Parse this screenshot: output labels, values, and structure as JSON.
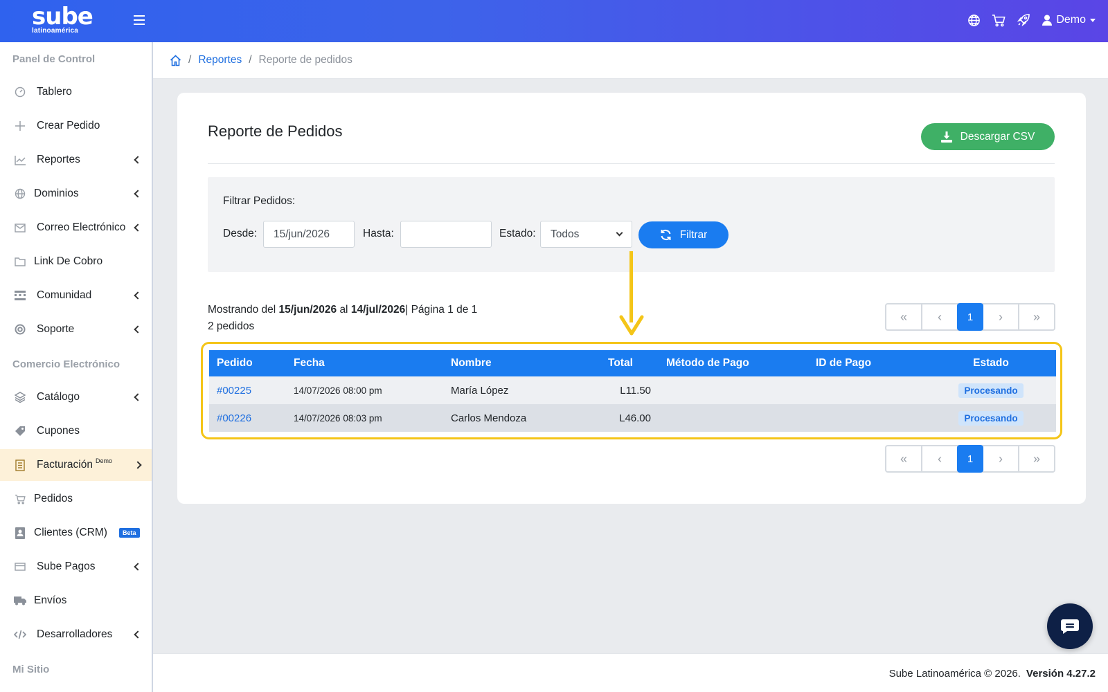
{
  "brand": {
    "name": "sube",
    "tagline": "latinoamérica"
  },
  "header": {
    "user": "Demo"
  },
  "sidebar": {
    "sections": [
      "Panel de Control",
      "Comercio Electrónico",
      "Mi Sitio"
    ],
    "items": [
      {
        "label": "Tablero",
        "icon": "dashboard-icon"
      },
      {
        "label": "Crear Pedido",
        "icon": "plus-icon"
      },
      {
        "label": "Reportes",
        "icon": "chart-icon"
      },
      {
        "label": "Dominios",
        "icon": "globe-icon"
      },
      {
        "label": "Correo Electrónico",
        "icon": "mail-icon"
      },
      {
        "label": "Link De Cobro",
        "icon": "folder-icon"
      },
      {
        "label": "Comunidad",
        "icon": "community-icon"
      },
      {
        "label": "Soporte",
        "icon": "lifebuoy-icon"
      },
      {
        "label": "Catálogo",
        "icon": "layers-icon"
      },
      {
        "label": "Cupones",
        "icon": "tag-icon"
      },
      {
        "label": "Facturación",
        "sup": "Demo",
        "icon": "invoice-icon"
      },
      {
        "label": "Pedidos",
        "icon": "cart-icon"
      },
      {
        "label": "Clientes (CRM)",
        "badge": "Beta",
        "icon": "contacts-icon"
      },
      {
        "label": "Sube Pagos",
        "icon": "card-icon"
      },
      {
        "label": "Envíos",
        "icon": "truck-icon"
      },
      {
        "label": "Desarrolladores",
        "icon": "code-icon"
      }
    ]
  },
  "breadcrumb": {
    "link": "Reportes",
    "current": "Reporte de pedidos"
  },
  "page": {
    "title": "Reporte de Pedidos",
    "download_label": "Descargar CSV",
    "filter": {
      "title": "Filtrar Pedidos:",
      "from_label": "Desde:",
      "from_value": "15/jun/2026",
      "to_label": "Hasta:",
      "to_value": "",
      "status_label": "Estado:",
      "status_value": "Todos",
      "button_label": "Filtrar"
    },
    "summary": {
      "prefix": "Mostrando del",
      "from": "15/jun/2026",
      "mid": "al",
      "to": "14/jul/2026",
      "page_text": "| Página 1 de 1",
      "count": "2 pedidos"
    },
    "pagination": {
      "current": "1"
    },
    "table": {
      "headers": [
        "Pedido",
        "Fecha",
        "Nombre",
        "Total",
        "Método de Pago",
        "ID de Pago",
        "Estado"
      ],
      "rows": [
        {
          "order": "#00225",
          "date": "14/07/2026 08:00 pm",
          "name": "María López",
          "total": "L11.50",
          "method": "",
          "payment_id": "",
          "status": "Procesando"
        },
        {
          "order": "#00226",
          "date": "14/07/2026 08:03 pm",
          "name": "Carlos Mendoza",
          "total": "L46.00",
          "method": "",
          "payment_id": "",
          "status": "Procesando"
        }
      ]
    }
  },
  "footer": {
    "copyright": "Sube Latinoamérica © 2026.",
    "version": "Versión 4.27.2"
  },
  "colors": {
    "primary": "#1a7cf0",
    "success": "#3fb066",
    "highlight": "#f4c518",
    "active_item_bg": "#fdf1d9"
  }
}
